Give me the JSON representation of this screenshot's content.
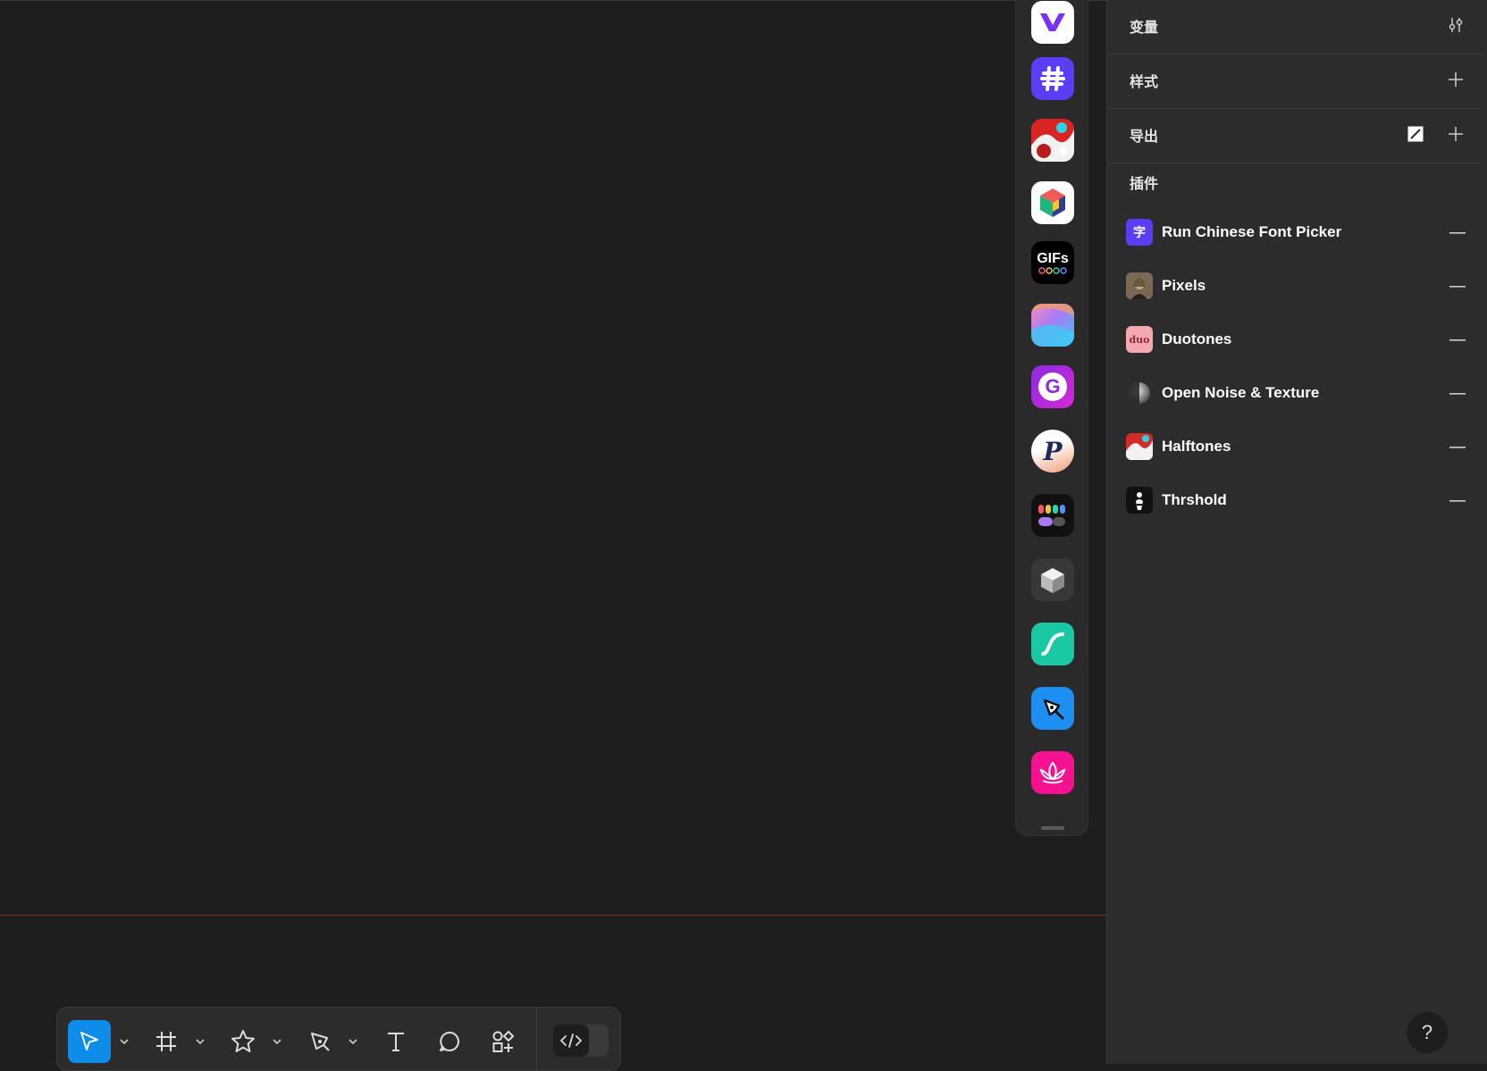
{
  "panel": {
    "sections": [
      {
        "label": "变量",
        "action": "sliders-icon"
      },
      {
        "label": "样式",
        "action": "plus-icon"
      },
      {
        "label": "导出",
        "action": "plus-icon"
      }
    ],
    "plugins_title": "插件",
    "plugins": [
      {
        "name": "Run Chinese Font Picker",
        "icon_text": "字",
        "color": "#5b3df5"
      },
      {
        "name": "Pixels",
        "icon_text": "",
        "color": "#6b5a48"
      },
      {
        "name": "Duotones",
        "icon_text": "duo",
        "color": "#f4a8b0"
      },
      {
        "name": "Open Noise & Texture",
        "icon_text": "",
        "color": "#444444"
      },
      {
        "name": "Halftones",
        "icon_text": "",
        "color": "#d42a2a"
      },
      {
        "name": "Thrshold",
        "icon_text": "",
        "color": "#111111"
      }
    ],
    "help_label": "?"
  },
  "dock": {
    "gifs_label": "GIFs",
    "g_label": "G",
    "p_label": "P"
  },
  "colors": {
    "accent": "#0d8ce9",
    "canvas": "#1e1e1e",
    "panel": "#2c2c2c",
    "guide": "#7a3318"
  }
}
